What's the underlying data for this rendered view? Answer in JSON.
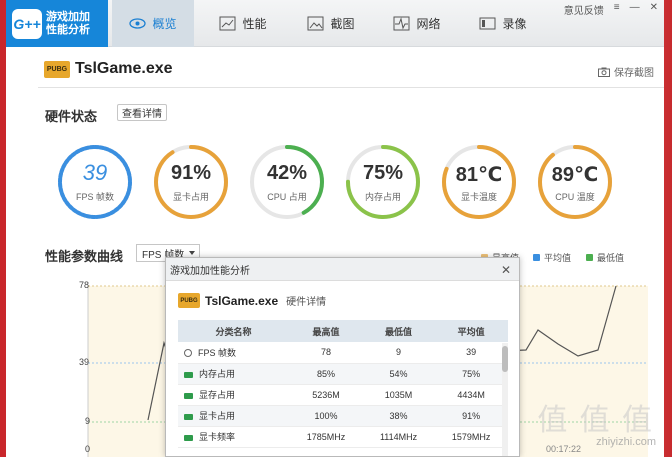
{
  "app": {
    "logo_mark": "G++",
    "logo_line1": "游戏加加",
    "logo_line2": "性能分析"
  },
  "tabs": [
    {
      "label": "概览",
      "icon": "eye-icon",
      "active": true
    },
    {
      "label": "性能",
      "icon": "bar-chart-icon",
      "active": false
    },
    {
      "label": "截图",
      "icon": "image-icon",
      "active": false
    },
    {
      "label": "网络",
      "icon": "pulse-icon",
      "active": false
    },
    {
      "label": "录像",
      "icon": "video-icon",
      "active": false
    }
  ],
  "window_controls": {
    "feedback": "意见反馈",
    "menu": "≡",
    "minimize": "—",
    "close": "✕"
  },
  "game": {
    "badge": "PUBG",
    "name": "TslGame.exe"
  },
  "save_screenshot": "保存截图",
  "hardware": {
    "title": "硬件状态",
    "details_button": "查看详情",
    "gauges": [
      {
        "value": "39",
        "label": "FPS 帧数",
        "fraction": 0.75,
        "color": "#3a8fe0"
      },
      {
        "value": "91%",
        "label": "显卡占用",
        "fraction": 0.91,
        "color": "#e7a23a"
      },
      {
        "value": "42%",
        "label": "CPU 占用",
        "fraction": 0.42,
        "color": "#4caf50"
      },
      {
        "value": "75%",
        "label": "内存占用",
        "fraction": 0.75,
        "color": "#8bc34a"
      },
      {
        "value": "81℃",
        "label": "显卡温度",
        "fraction": 0.81,
        "color": "#e7a23a"
      },
      {
        "value": "89℃",
        "label": "CPU 温度",
        "fraction": 0.89,
        "color": "#e7a23a"
      }
    ]
  },
  "perf_curve": {
    "title": "性能参数曲线",
    "selected_metric": "FPS 帧数",
    "legend": [
      {
        "label": "最高值",
        "color": "#f0c37a"
      },
      {
        "label": "平均值",
        "color": "#3a8fe0"
      },
      {
        "label": "最低值",
        "color": "#4caf50"
      }
    ],
    "y_labels": [
      "78",
      "39",
      "9",
      "0"
    ],
    "time_label": "00:17:22"
  },
  "dialog": {
    "title": "游戏加加性能分析",
    "close": "✕",
    "game_badge": "PUBG",
    "game_name": "TslGame.exe",
    "subtitle": "硬件详情",
    "headers": [
      "分类名称",
      "最高值",
      "最低值",
      "平均值"
    ],
    "rows": [
      {
        "icon": "fps-icon",
        "name": "FPS 帧数",
        "max": "78",
        "min": "9",
        "avg": "39"
      },
      {
        "icon": "memory-icon",
        "name": "内存占用",
        "max": "85%",
        "min": "54%",
        "avg": "75%"
      },
      {
        "icon": "gpu-memory-icon",
        "name": "显存占用",
        "max": "5236M",
        "min": "1035M",
        "avg": "4434M"
      },
      {
        "icon": "gpu-icon",
        "name": "显卡占用",
        "max": "100%",
        "min": "38%",
        "avg": "91%"
      },
      {
        "icon": "gpu-clock-icon",
        "name": "显卡频率",
        "max": "1785MHz",
        "min": "1114MHz",
        "avg": "1579MHz"
      }
    ]
  },
  "watermark": {
    "text": "值 值 值",
    "site": "zhiyizhi.com"
  }
}
